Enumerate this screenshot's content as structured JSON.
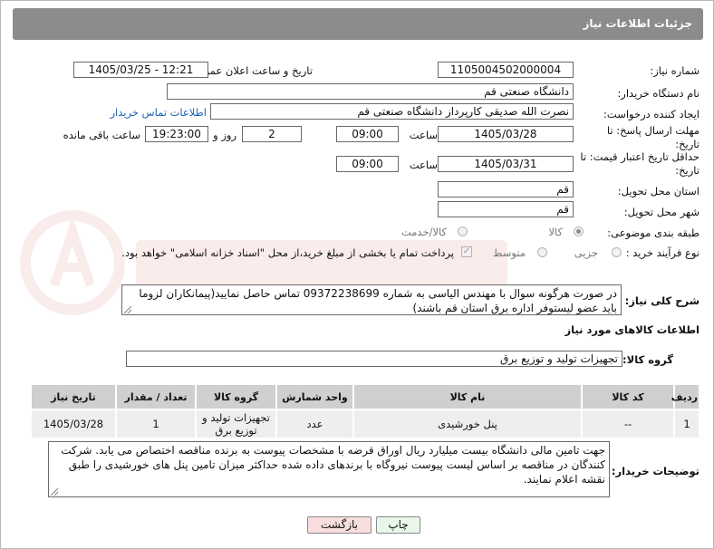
{
  "header": {
    "title": "جزئیات اطلاعات نیاز"
  },
  "form": {
    "need_number_label": "شماره نیاز:",
    "need_number": "1105004502000004",
    "announce_label": "تاریخ و ساعت اعلان عمومی:",
    "announce_value": "1405/03/25 - 12:21",
    "buyer_org_label": "نام دستگاه خریدار:",
    "buyer_org": "دانشگاه صنعتی قم",
    "requester_label": "ایجاد کننده درخواست:",
    "requester": "نصرت الله صدیقی کارپرداز دانشگاه صنعتی قم",
    "buyer_contact_link": "اطلاعات تماس خریدار",
    "reply_deadline_label": "مهلت ارسال پاسخ: تا تاریخ:",
    "reply_date": "1405/03/28",
    "time_label": "ساعت",
    "reply_time": "09:00",
    "day_label": "روز و",
    "reply_days": "2",
    "remaining_time": "19:23:00",
    "remaining_label": "ساعت باقی مانده",
    "price_validity_label": "حداقل تاریخ اعتبار قیمت: تا تاریخ:",
    "price_date": "1405/03/31",
    "price_time": "09:00",
    "delivery_province_label": "استان محل تحویل:",
    "delivery_province": "قم",
    "delivery_city_label": "شهر محل تحویل:",
    "delivery_city": "قم",
    "category_label": "طبقه بندی موضوعی:",
    "category_options": [
      "کالا",
      "کالا/خدمت"
    ],
    "process_label": "نوع فرآیند خرید :",
    "process_options": [
      "جزیی",
      "متوسط"
    ],
    "payment_note": "پرداخت تمام یا بخشی از مبلغ خرید،از محل \"اسناد خزانه اسلامی\" خواهد بود.",
    "description_label": "شرح کلی نیاز:",
    "description": "در صورت هرگونه سوال با مهندس الیاسی به شماره 09372238699 تماس حاصل نمایید(پیمانکاران لزوما باید عضو لیستوفر اداره برق استان قم باشند)",
    "goods_info_title": "اطلاعات کالاهای مورد نیاز",
    "goods_group_label": "گروه کالا:",
    "goods_group": "تجهیزات تولید و توزیع برق",
    "buyer_notes_label": "توضیحات خریدار:",
    "buyer_notes": "جهت تامین مالی دانشگاه بیست میلیارد ریال اوراق قرضه با مشخصات پیوست به برنده مناقصه اختصاص می یابد. شرکت کنندگان در مناقصه بر اساس لیست پیوست نیروگاه با برندهای داده شده حداکثر میزان تامین پنل های خورشیدی را طبق نقشه اعلام نمایند."
  },
  "table": {
    "headers": [
      "ردیف",
      "کد کالا",
      "نام کالا",
      "واحد شمارش",
      "گروه کالا",
      "تعداد / مقدار",
      "تاریخ نیاز"
    ],
    "rows": [
      [
        "1",
        "--",
        "پنل خورشیدی",
        "عدد",
        "تجهیزات تولید و توزیع برق",
        "1",
        "1405/03/28"
      ]
    ]
  },
  "buttons": {
    "print": "چاپ",
    "back": "بازگشت"
  },
  "colors": {
    "header_bg": "#8c8c8c",
    "table_header": "#cfcfcf",
    "table_cell": "#eeeeee",
    "back_button": "#f8dede",
    "print_button": "#e9f7e9"
  }
}
